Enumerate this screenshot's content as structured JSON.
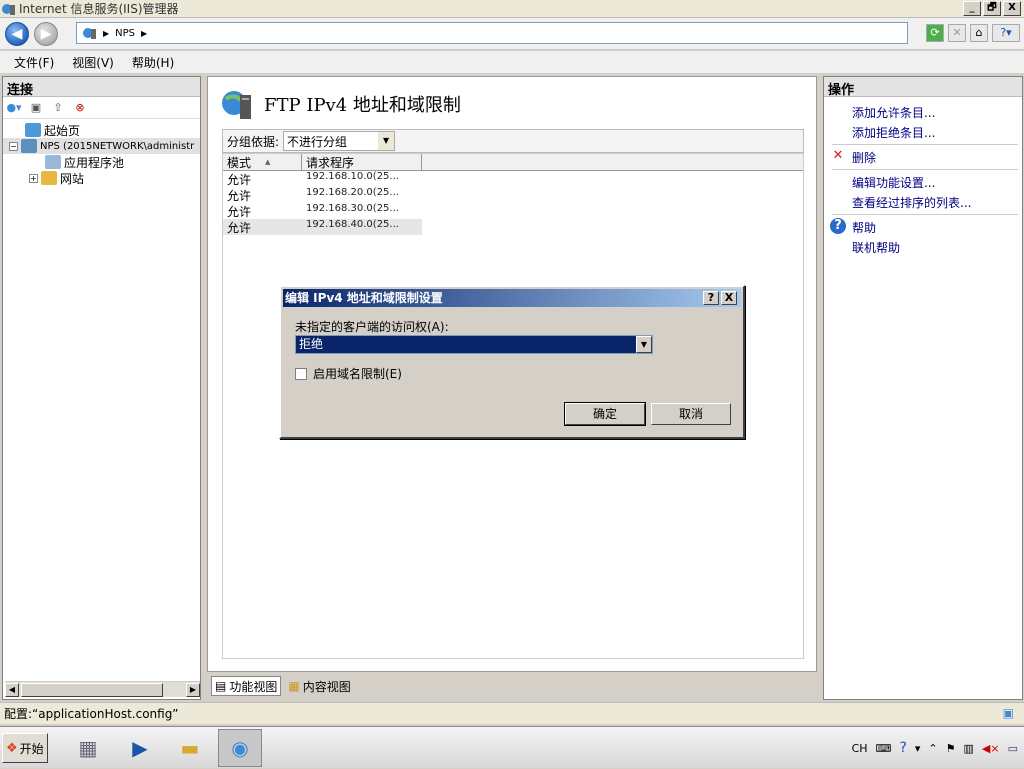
{
  "window": {
    "title": "Internet 信息服务(IIS)管理器",
    "controls": [
      "_",
      "🗗",
      "X"
    ]
  },
  "address": {
    "path_items": [
      "NPS"
    ]
  },
  "menu": {
    "file": "文件(F)",
    "view": "视图(V)",
    "help": "帮助(H)"
  },
  "connections": {
    "header": "连接",
    "tree": {
      "start_page": "起始页",
      "server": "NPS (2015NETWORK\\administr",
      "app_pools": "应用程序池",
      "sites": "网站"
    }
  },
  "feature": {
    "title": "FTP IPv4 地址和域限制",
    "group_label": "分组依据:",
    "group_value": "不进行分组",
    "columns": [
      "模式",
      "请求程序"
    ],
    "rows": [
      {
        "mode": "允许",
        "requester": "192.168.10.0(25..."
      },
      {
        "mode": "允许",
        "requester": "192.168.20.0(25..."
      },
      {
        "mode": "允许",
        "requester": "192.168.30.0(25..."
      },
      {
        "mode": "允许",
        "requester": "192.168.40.0(25..."
      }
    ],
    "views": {
      "features": "功能视图",
      "content": "内容视图"
    }
  },
  "actions": {
    "header": "操作",
    "add_allow": "添加允许条目...",
    "add_deny": "添加拒绝条目...",
    "delete": "删除",
    "edit_settings": "编辑功能设置...",
    "view_ordered": "查看经过排序的列表...",
    "help": "帮助",
    "online_help": "联机帮助"
  },
  "dialog": {
    "title": "编辑 IPv4 地址和域限制设置",
    "access_label": "未指定的客户端的访问权(A):",
    "access_value": "拒绝",
    "domain_check_label": "启用域名限制(E)",
    "domain_check_checked": false,
    "ok": "确定",
    "cancel": "取消",
    "help_btn": "?",
    "close_btn": "X"
  },
  "status": {
    "text": "配置:“applicationHost.config”"
  },
  "taskbar": {
    "start": "开始",
    "lang": "CH"
  }
}
